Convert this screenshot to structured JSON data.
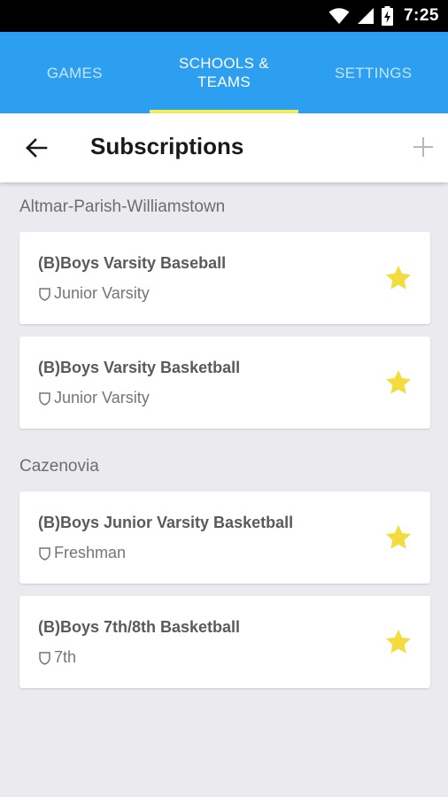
{
  "status_bar": {
    "time": "7:25"
  },
  "tabs": [
    {
      "label": "GAMES",
      "active": false
    },
    {
      "label": "SCHOOLS & TEAMS",
      "active": true
    },
    {
      "label": "SETTINGS",
      "active": false
    }
  ],
  "toolbar": {
    "title": "Subscriptions"
  },
  "colors": {
    "tabbar": "#2d9ff0",
    "indicator": "#f1ec57",
    "star": "#f3dc3b",
    "background": "#ebebef"
  },
  "icons": {
    "back": "arrow-left-icon",
    "add": "plus-icon",
    "star": "star-icon",
    "shield": "shield-icon"
  },
  "groups": [
    {
      "school": "Altmar-Parish-Williamstown",
      "teams": [
        {
          "name": "(B)Boys Varsity Baseball",
          "level": "Junior Varsity"
        },
        {
          "name": "(B)Boys Varsity Basketball",
          "level": "Junior Varsity"
        }
      ]
    },
    {
      "school": "Cazenovia",
      "teams": [
        {
          "name": "(B)Boys Junior Varsity Basketball",
          "level": "Freshman"
        },
        {
          "name": "(B)Boys 7th/8th Basketball",
          "level": "7th"
        }
      ]
    }
  ]
}
